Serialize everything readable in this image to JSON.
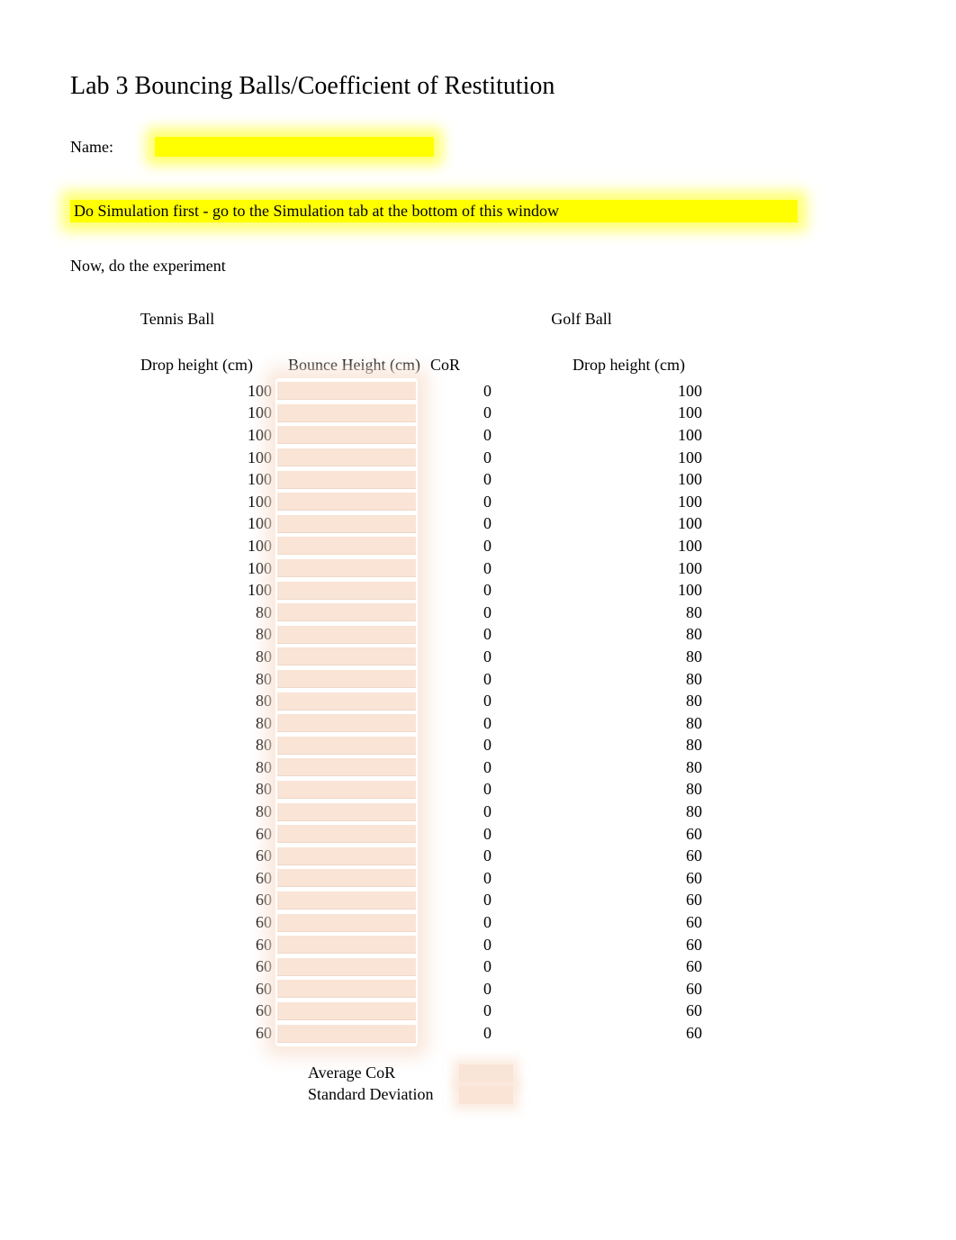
{
  "title": "Lab 3 Bouncing Balls/Coefficient of Restitution",
  "nameLabel": "Name:",
  "instruction": "Do Simulation first - go to the Simulation tab at the bottom of this window",
  "subheading": "Now, do the experiment",
  "ballLabels": {
    "tennis": "Tennis Ball",
    "golf": "Golf Ball"
  },
  "headers": {
    "drop1": "Drop height (cm)",
    "bounce": "Bounce Height (cm)",
    "cor": "CoR",
    "drop2": "Drop height (cm)"
  },
  "rows": [
    {
      "drop1": "100",
      "cor": "0",
      "drop2": "100"
    },
    {
      "drop1": "100",
      "cor": "0",
      "drop2": "100"
    },
    {
      "drop1": "100",
      "cor": "0",
      "drop2": "100"
    },
    {
      "drop1": "100",
      "cor": "0",
      "drop2": "100"
    },
    {
      "drop1": "100",
      "cor": "0",
      "drop2": "100"
    },
    {
      "drop1": "100",
      "cor": "0",
      "drop2": "100"
    },
    {
      "drop1": "100",
      "cor": "0",
      "drop2": "100"
    },
    {
      "drop1": "100",
      "cor": "0",
      "drop2": "100"
    },
    {
      "drop1": "100",
      "cor": "0",
      "drop2": "100"
    },
    {
      "drop1": "100",
      "cor": "0",
      "drop2": "100"
    },
    {
      "drop1": "80",
      "cor": "0",
      "drop2": "80"
    },
    {
      "drop1": "80",
      "cor": "0",
      "drop2": "80"
    },
    {
      "drop1": "80",
      "cor": "0",
      "drop2": "80"
    },
    {
      "drop1": "80",
      "cor": "0",
      "drop2": "80"
    },
    {
      "drop1": "80",
      "cor": "0",
      "drop2": "80"
    },
    {
      "drop1": "80",
      "cor": "0",
      "drop2": "80"
    },
    {
      "drop1": "80",
      "cor": "0",
      "drop2": "80"
    },
    {
      "drop1": "80",
      "cor": "0",
      "drop2": "80"
    },
    {
      "drop1": "80",
      "cor": "0",
      "drop2": "80"
    },
    {
      "drop1": "80",
      "cor": "0",
      "drop2": "80"
    },
    {
      "drop1": "60",
      "cor": "0",
      "drop2": "60"
    },
    {
      "drop1": "60",
      "cor": "0",
      "drop2": "60"
    },
    {
      "drop1": "60",
      "cor": "0",
      "drop2": "60"
    },
    {
      "drop1": "60",
      "cor": "0",
      "drop2": "60"
    },
    {
      "drop1": "60",
      "cor": "0",
      "drop2": "60"
    },
    {
      "drop1": "60",
      "cor": "0",
      "drop2": "60"
    },
    {
      "drop1": "60",
      "cor": "0",
      "drop2": "60"
    },
    {
      "drop1": "60",
      "cor": "0",
      "drop2": "60"
    },
    {
      "drop1": "60",
      "cor": "0",
      "drop2": "60"
    },
    {
      "drop1": "60",
      "cor": "0",
      "drop2": "60"
    }
  ],
  "summary": {
    "avgLabel": "Average CoR",
    "stdLabel": "Standard Deviation"
  }
}
